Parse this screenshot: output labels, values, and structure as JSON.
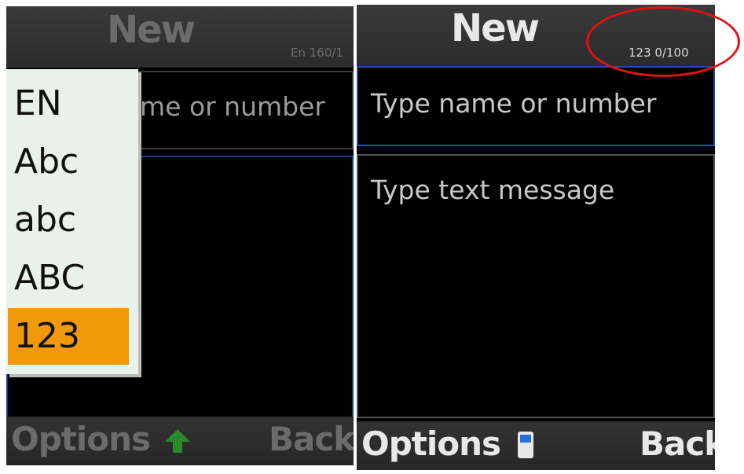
{
  "left_screen": {
    "title": "New",
    "counter": "En 160/1",
    "recipient_placeholder": "me or number",
    "options_label": "Options",
    "back_label": "Back",
    "input_mode_menu": {
      "items": [
        "EN",
        "Abc",
        "abc",
        "ABC",
        "123"
      ],
      "selected": "123"
    },
    "colors": {
      "selection": "#f09a0a",
      "arrow": "#2a8a2a"
    }
  },
  "right_screen": {
    "title": "New",
    "counter": "123 0/100",
    "recipient_placeholder": "Type name or number",
    "message_placeholder": "Type text message",
    "options_label": "Options",
    "back_label": "Back",
    "colors": {
      "focus_border": "#1e4fb0"
    }
  },
  "annotation": {
    "color": "#e21212",
    "shape": "oval"
  }
}
